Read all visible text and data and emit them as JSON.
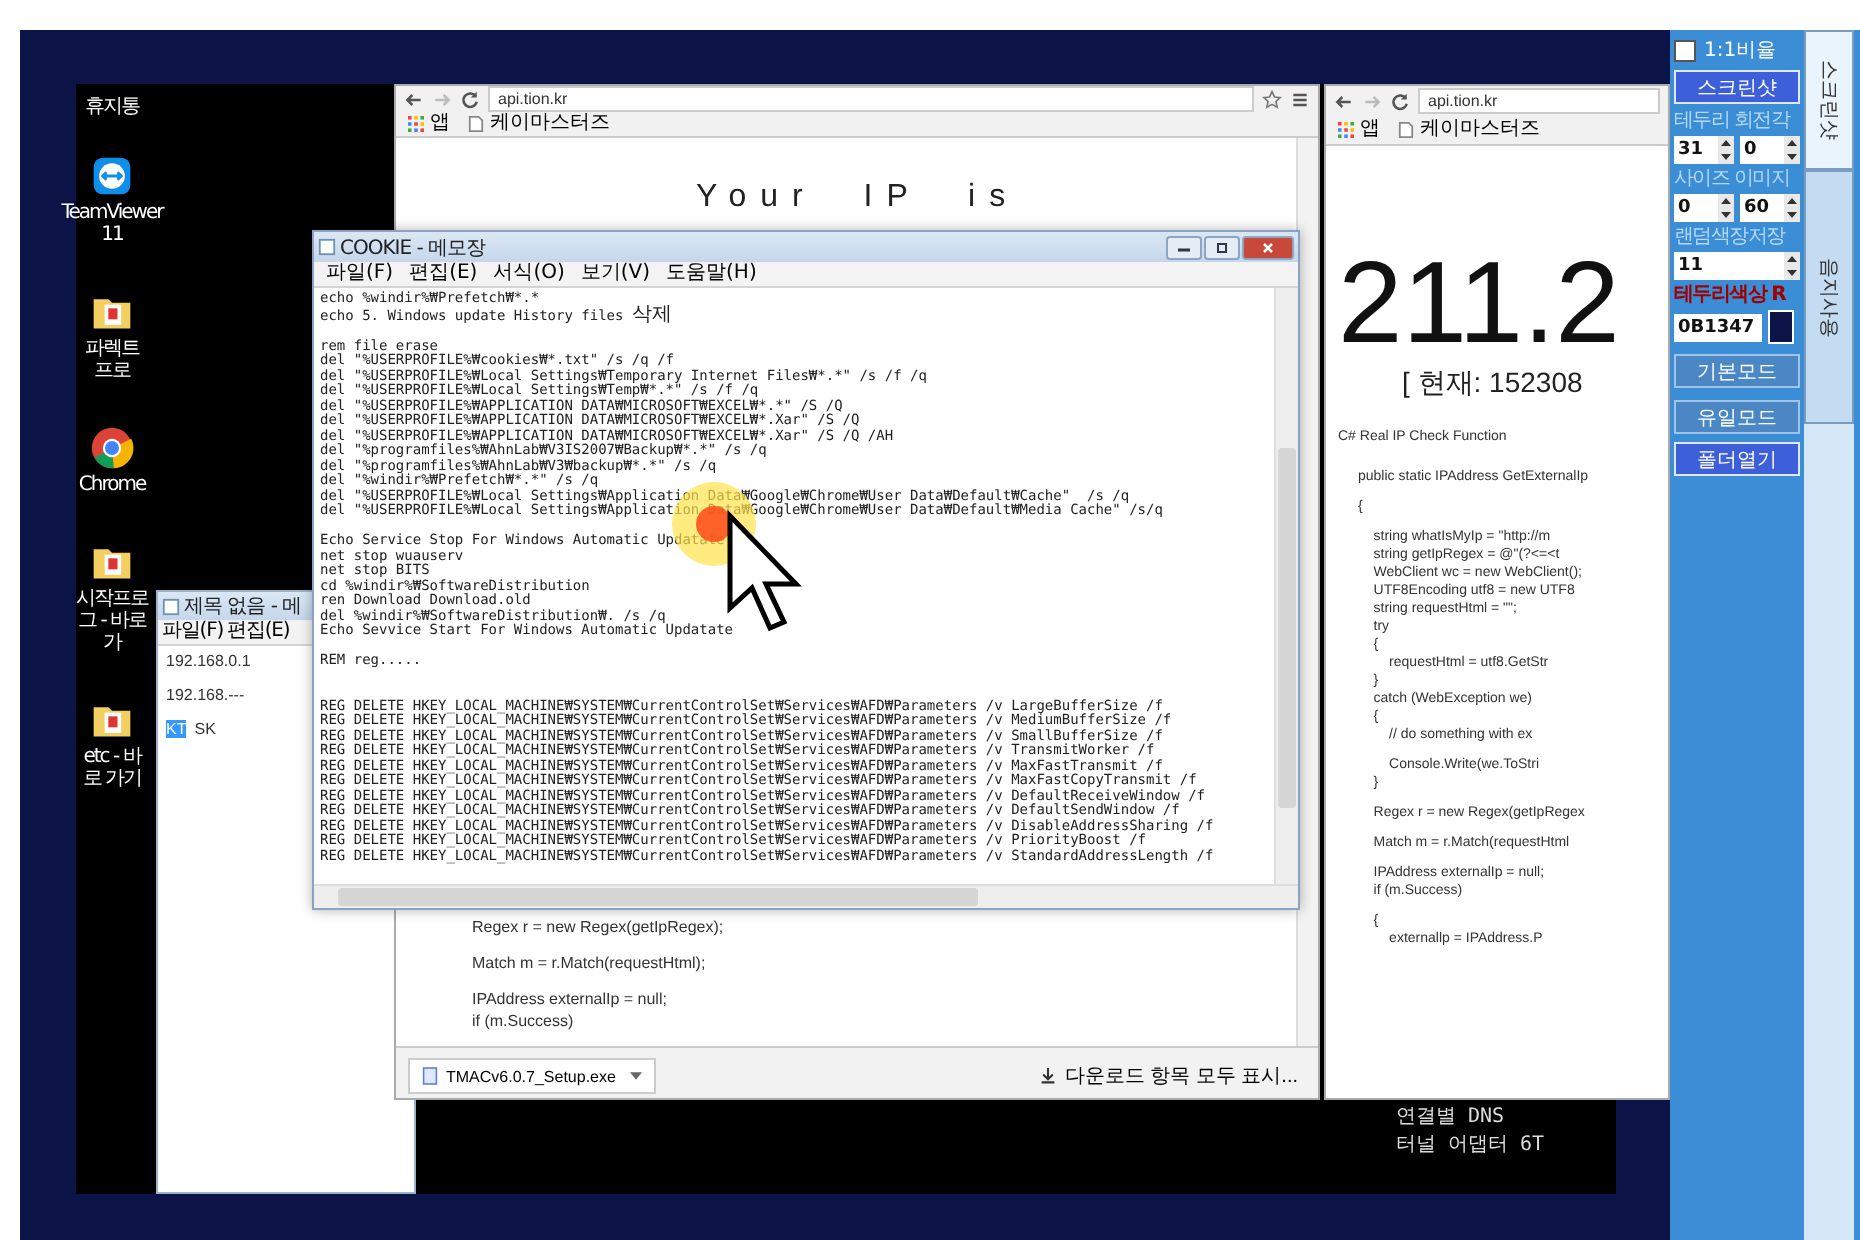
{
  "desktop_icons": [
    {
      "label": "휴지통",
      "kind": "none"
    },
    {
      "label": "TeamViewer 11",
      "kind": "app"
    },
    {
      "label": "파렉트 프로",
      "kind": "folder"
    },
    {
      "label": "Chrome",
      "kind": "chrome"
    },
    {
      "label": "시작프로그 - 바로 가",
      "kind": "folder"
    },
    {
      "label": "etc - 바로 가기",
      "kind": "folder"
    }
  ],
  "small_notepad": {
    "title": "제목 없음 - 메",
    "menu": [
      "파일(F)",
      "편집(E)"
    ],
    "lines": [
      [
        {
          "text": "192.168.0.1",
          "selected": false
        }
      ],
      [
        {
          "text": "192.168.---",
          "selected": false
        }
      ],
      [
        {
          "text": "KT",
          "selected": true
        },
        {
          "text": "SK",
          "selected": false
        }
      ]
    ]
  },
  "browser_left": {
    "url": "api.tion.kr",
    "bookmarks": [
      "앱",
      "케이마스터즈"
    ],
    "heading": "Your IP is",
    "code_blocks": [
      [
        "Regex r = new Regex(getIpRegex);"
      ],
      [
        "Match m = r.Match(requestHtml);"
      ],
      [
        "IPAddress externalIp = null;",
        "if (m.Success)"
      ]
    ],
    "download": {
      "file": "TMACv6.0.7_Setup.exe",
      "show_all": "다운로드 항목 모두 표시..."
    }
  },
  "browser_right": {
    "url": "api.tion.kr",
    "bookmarks": [
      "앱",
      "케이마스터즈"
    ],
    "ip": "211.2",
    "current": "[ 현재: 152308",
    "caption": "C# Real IP Check Function",
    "code_blocks": [
      [
        "public static IPAddress GetExternalIp"
      ],
      [
        "{"
      ],
      [
        "    string whatIsMyIp = \"http://m",
        "    string getIpRegex = @\"(?<=<t",
        "    WebClient wc = new WebClient();",
        "    UTF8Encoding utf8 = new UTF8",
        "    string requestHtml = \"\";",
        "    try",
        "    {",
        "        requestHtml = utf8.GetStr",
        "    }",
        "    catch (WebException we)",
        "    {",
        "        // do something with ex"
      ],
      [
        "        Console.Write(we.ToStri",
        "    }"
      ],
      [
        "    Regex r = new Regex(getIpRegex"
      ],
      [
        "    Match m = r.Match(requestHtml"
      ],
      [
        "    IPAddress externalIp = null;",
        "    if (m.Success)"
      ],
      [
        "    {",
        "        externallp = IPAddress.P"
      ]
    ]
  },
  "console_lines": [
    "연결별 DNS",
    "터널 어댑터 6T"
  ],
  "cookie_notepad": {
    "title": "COOKIE - 메모장",
    "menu": [
      "파일(F)",
      "편집(E)",
      "서식(O)",
      "보기(V)",
      "도움말(H)"
    ],
    "blocks": [
      [
        "echo %windir%₩Prefetch₩*.*",
        "echo 5. Windows update History files 삭제"
      ],
      [
        "rem file erase",
        "del \"%USERPROFILE%₩cookies₩*.txt\" /s /q /f",
        "del \"%USERPROFILE%₩Local Settings₩Temporary Internet Files₩*.*\" /s /f /q",
        "del \"%USERPROFILE%₩Local Settings₩Temp₩*.*\" /s /f /q",
        "del \"%USERPROFILE%₩APPLICATION DATA₩MICROSOFT₩EXCEL₩*.*\" /S /Q",
        "del \"%USERPROFILE%₩APPLICATION DATA₩MICROSOFT₩EXCEL₩*.Xar\" /S /Q",
        "del \"%USERPROFILE%₩APPLICATION DATA₩MICROSOFT₩EXCEL₩*.Xar\" /S /Q /AH",
        "del \"%programfiles%₩AhnLab₩V3IS2007₩Backup₩*.*\" /s /q",
        "del \"%programfiles%₩AhnLab₩V3₩backup₩*.*\" /s /q",
        "del \"%windir%₩Prefetch₩*.*\" /s /q",
        "del \"%USERPROFILE%₩Local Settings₩Application Data₩Google₩Chrome₩User Data₩Default₩Cache\"  /s /q",
        "del \"%USERPROFILE%₩Local Settings₩Application Data₩Google₩Chrome₩User Data₩Default₩Media Cache\" /s/q"
      ],
      [
        "Echo Service Stop For Windows Automatic Updatate",
        "net stop wuauserv",
        "net stop BITS",
        "cd %windir%₩SoftwareDistribution",
        "ren Download Download.old",
        "del %windir%₩SoftwareDistribution₩. /s /q",
        "Echo Sevvice Start For Windows Automatic Updatate"
      ],
      [
        "REM reg....."
      ],
      [
        "REG DELETE HKEY_LOCAL_MACHINE₩SYSTEM₩CurrentControlSet₩Services₩AFD₩Parameters /v LargeBufferSize /f",
        "REG DELETE HKEY_LOCAL_MACHINE₩SYSTEM₩CurrentControlSet₩Services₩AFD₩Parameters /v MediumBufferSize /f",
        "REG DELETE HKEY_LOCAL_MACHINE₩SYSTEM₩CurrentControlSet₩Services₩AFD₩Parameters /v SmallBufferSize /f",
        "REG DELETE HKEY_LOCAL_MACHINE₩SYSTEM₩CurrentControlSet₩Services₩AFD₩Parameters /v TransmitWorker /f",
        "REG DELETE HKEY_LOCAL_MACHINE₩SYSTEM₩CurrentControlSet₩Services₩AFD₩Parameters /v MaxFastTransmit /f",
        "REG DELETE HKEY_LOCAL_MACHINE₩SYSTEM₩CurrentControlSet₩Services₩AFD₩Parameters /v MaxFastCopyTransmit /f",
        "REG DELETE HKEY_LOCAL_MACHINE₩SYSTEM₩CurrentControlSet₩Services₩AFD₩Parameters /v DefaultReceiveWindow /f",
        "REG DELETE HKEY_LOCAL_MACHINE₩SYSTEM₩CurrentControlSet₩Services₩AFD₩Parameters /v DefaultSendWindow /f",
        "REG DELETE HKEY_LOCAL_MACHINE₩SYSTEM₩CurrentControlSet₩Services₩AFD₩Parameters /v DisableAddressSharing /f",
        "REG DELETE HKEY_LOCAL_MACHINE₩SYSTEM₩CurrentControlSet₩Services₩AFD₩Parameters /v PriorityBoost /f",
        "REG DELETE HKEY_LOCAL_MACHINE₩SYSTEM₩CurrentControlSet₩Services₩AFD₩Parameters /v StandardAddressLength /f"
      ]
    ]
  },
  "panel": {
    "ratio": {
      "label": "1:1비율",
      "checked": false
    },
    "controls": [
      {
        "kind": "button",
        "label": "스크린샷"
      },
      {
        "kind": "label",
        "label": "테두리 회전각"
      },
      {
        "kind": "spinners",
        "values": [
          "31",
          "0"
        ]
      },
      {
        "kind": "label",
        "label": "사이즈 이미지"
      },
      {
        "kind": "spinners",
        "values": [
          "0",
          "60"
        ]
      },
      {
        "kind": "label",
        "label": "랜덤색장저장"
      },
      {
        "kind": "spinners",
        "values": [
          "11"
        ]
      },
      {
        "kind": "warn_label",
        "label": "테두리색상 R"
      },
      {
        "kind": "color",
        "value": "0B1347",
        "color": "#0b1347"
      },
      {
        "kind": "mode_button",
        "label": "기본모드"
      },
      {
        "kind": "mode_button",
        "label": "유일모드"
      },
      {
        "kind": "button",
        "label": "폴더열기"
      }
    ],
    "tabs": [
      {
        "label": "스크린샷",
        "selected": true
      },
      {
        "label": "음지사용",
        "selected": false
      }
    ]
  }
}
